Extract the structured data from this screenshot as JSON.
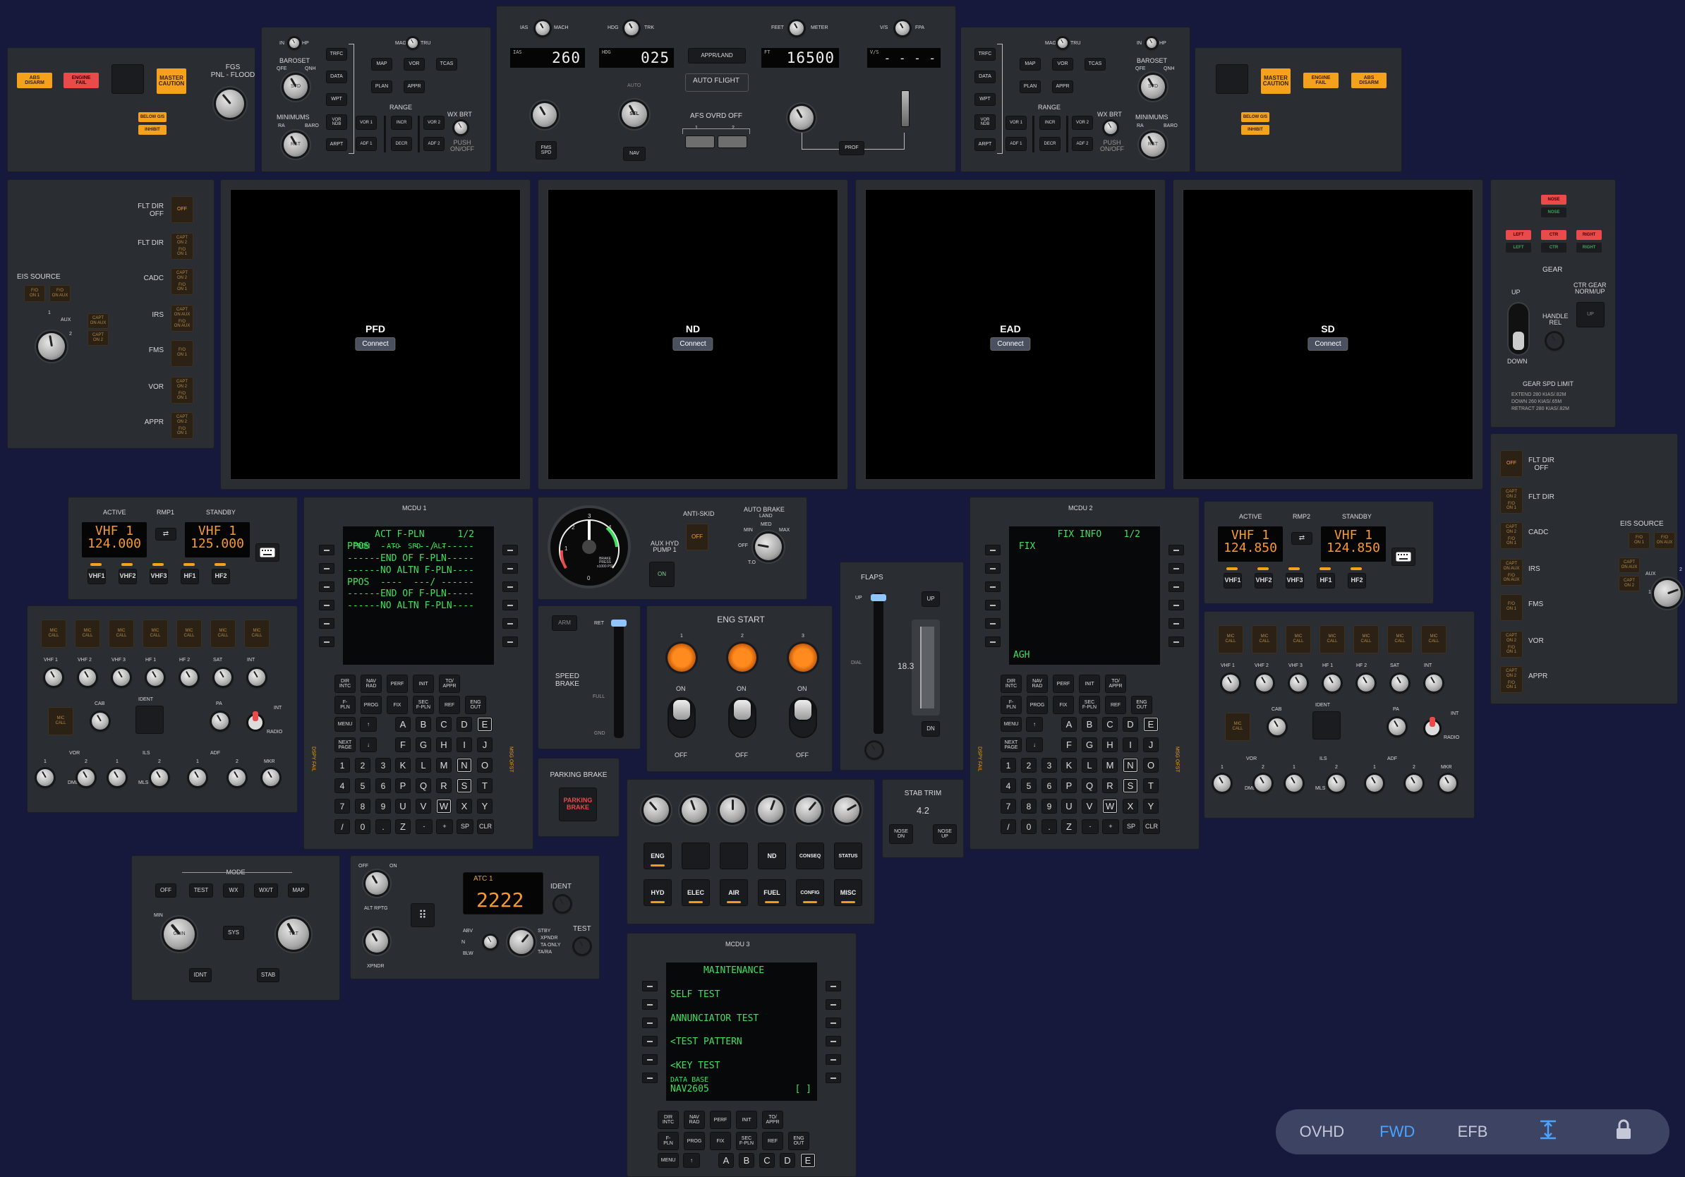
{
  "nav_bar": {
    "tabs": [
      "OVHD",
      "FWD",
      "EFB"
    ],
    "active": "FWD"
  },
  "displays": [
    {
      "title": "PFD",
      "button": "Connect"
    },
    {
      "title": "ND",
      "button": "Connect"
    },
    {
      "title": "EAD",
      "button": "Connect"
    },
    {
      "title": "SD",
      "button": "Connect"
    }
  ],
  "glare_left": {
    "abs_disarm": "ABS\nDISARM",
    "engine_fail": "ENGINE\nFAIL",
    "master_caution": "MASTER\nCAUTION",
    "below_gs": "BELOW G/S",
    "inhibit": "INHIBIT",
    "fgs_flood": "FGS\nPNL - FLOOD"
  },
  "efis_left": {
    "in": "IN",
    "hp": "HP",
    "baroset": "BAROSET",
    "qfe": "QFE",
    "qnh": "QNH",
    "std": "STD",
    "minimums": "MINIMUMS",
    "ra": "RA",
    "baro": "BARO",
    "rst": "RST",
    "mag": "MAG",
    "tru": "TRU",
    "trfc": "TRFC",
    "data": "DATA",
    "wpt": "WPT",
    "vor_ndb": "VOR\nNDB",
    "arpt": "ARPT",
    "map": "MAP",
    "vor": "VOR",
    "tcas": "TCAS",
    "plan": "PLAN",
    "appr": "APPR",
    "range": "RANGE",
    "vor1": "VOR 1",
    "incr": "INCR",
    "vor2": "VOR 2",
    "adf1": "ADF 1",
    "decr": "DECR",
    "adf2": "ADF 2",
    "wx_brt": "WX BRT",
    "push_onoff": "PUSH\nON/OFF"
  },
  "fcp": {
    "ias": "IAS",
    "mach": "MACH",
    "hdg": "HDG",
    "trk": "TRK",
    "feet": "FEET",
    "meter": "METER",
    "vs": "V/S",
    "fpa": "FPA",
    "ias_value": "260",
    "hdg_value": "025",
    "ft_value": "16500",
    "vs_value": "- - - -",
    "ias_tag": "IAS",
    "hdg_tag": "HDG",
    "ft_tag": "FT",
    "vs_tag": "V/S",
    "appr_land": "APPR/LAND",
    "auto_flight": "AUTO FLIGHT",
    "afs_ovrd_off": "AFS OVRD OFF",
    "one": "1",
    "two": "2",
    "fms_spd": "FMS\nSPD",
    "nav": "NAV",
    "prof": "PROF",
    "sel": "SEL",
    "auto": "AUTO"
  },
  "efis_right": {
    "trfc": "TRFC",
    "data": "DATA",
    "wpt": "WPT",
    "vor_ndb": "VOR\nNDB",
    "arpt": "ARPT",
    "mag": "MAG",
    "tru": "TRU",
    "map": "MAP",
    "vor": "VOR",
    "tcas": "TCAS",
    "plan": "PLAN",
    "appr": "APPR",
    "range": "RANGE",
    "vor1": "VOR 1",
    "incr": "INCR",
    "vor2": "VOR 2",
    "adf1": "ADF 1",
    "decr": "DECR",
    "adf2": "ADF 2",
    "in": "IN",
    "hp": "HP",
    "baroset": "BAROSET",
    "qfe": "QFE",
    "qnh": "QNH",
    "std": "STD",
    "wx_brt": "WX BRT",
    "push_onoff": "PUSH\nON/OFF",
    "minimums": "MINIMUMS",
    "ra": "RA",
    "baro": "BARO",
    "rst": "RST"
  },
  "glare_right": {
    "master_caution": "MASTER\nCAUTION",
    "engine_fail": "ENGINE\nFAIL",
    "abs_disarm": "ABS\nDISARM",
    "below_gs": "BELOW G/S",
    "inhibit": "INHIBIT"
  },
  "source_left": {
    "rows": [
      "FLT DIR\nOFF",
      "FLT DIR",
      "CADC",
      "IRS",
      "FMS",
      "VOR",
      "APPR"
    ],
    "eis_source": "EIS SOURCE",
    "fo_on1": "F/O\nON 1",
    "fo_on_aux": "F/O\nON AUX",
    "capt_on_aux": "CAPT\nON AUX",
    "capt_on2": "CAPT\nON 2",
    "aux": "AUX",
    "one": "1",
    "two": "2",
    "off": "OFF",
    "capt_on_2": "CAPT\nON 2",
    "fo_on_1": "F/O\nON 1"
  },
  "source_right": {
    "rows": [
      "FLT DIR\nOFF",
      "FLT DIR",
      "CADC",
      "IRS",
      "FMS",
      "VOR",
      "APPR"
    ],
    "eis_source": "EIS SOURCE",
    "fo_on1": "F/O\nON 1",
    "fo_on_aux": "F/O\nON AUX",
    "capt_on_aux": "CAPT\nON AUX",
    "capt_on2": "CAPT\nON 2",
    "aux": "AUX",
    "one": "1",
    "two": "2"
  },
  "gear": {
    "nose": "NOSE",
    "left": "LEFT",
    "ctr": "CTR",
    "right": "RIGHT",
    "title": "GEAR",
    "up": "UP",
    "down": "DOWN",
    "handle_rel": "HANDLE\nREL",
    "ctr_gear": "CTR GEAR\nNORM/UP",
    "gear_up": "UP",
    "spd_limit": "GEAR SPD LIMIT",
    "extend": "EXTEND 280 KIAS/.82M",
    "down_lim": "DOWN 260 KIAS/.65M",
    "retract": "RETRACT 280 KIAS/.82M"
  },
  "rmp1": {
    "active": "ACTIVE",
    "rmp": "RMP1",
    "standby": "STANDBY",
    "active_band": "VHF 1",
    "active_freq": "124.000",
    "standby_band": "VHF 1",
    "standby_freq": "125.000",
    "buttons": [
      "VHF1",
      "VHF2",
      "VHF3",
      "HF1",
      "HF2"
    ]
  },
  "rmp2": {
    "active": "ACTIVE",
    "rmp": "RMP2",
    "standby": "STANDBY",
    "active_band": "VHF 1",
    "active_freq": "124.850",
    "standby_band": "VHF 1",
    "standby_freq": "124.850",
    "buttons": [
      "VHF1",
      "VHF2",
      "VHF3",
      "HF1",
      "HF2"
    ]
  },
  "acp": {
    "mic_call": "MIC\nCALL",
    "channels": [
      "VHF 1",
      "VHF 2",
      "VHF 3",
      "HF 1",
      "HF 2",
      "SAT",
      "INT"
    ],
    "cab": "CAB",
    "ident": "IDENT",
    "pa": "PA",
    "int": "INT",
    "radio": "RADIO",
    "vor": "VOR",
    "ils": "ILS",
    "adf": "ADF",
    "mkr": "MKR",
    "dme": "DME",
    "mls": "MLS",
    "one": "1",
    "two": "2"
  },
  "mcdu1": {
    "title": "MCDU 1",
    "screen": "     ACT F-PLN      1/2\nPPOS  ----  ---/ ------\n------END OF F-PLN-----\n------NO ALTN F-PLN----\nPPOS  ----  ---/ ------\n------END OF F-PLN-----\n------NO ALTN F-PLN----",
    "hdr": "FROM    ATO  SPD   ALT"
  },
  "mcdu2": {
    "title": "MCDU 2",
    "screen": "        FIX INFO    1/2\n FIX",
    "bottom": "AGH"
  },
  "mcdu3": {
    "title": "MCDU 3",
    "screen": "      MAINTENANCE\n\nSELF TEST\n\nANNUNCIATOR TEST\n\n<TEST PATTERN\n\n<KEY TEST",
    "db": "DATA BASE",
    "db_ver": "NAV2605",
    "bracket": "[ ]"
  },
  "mcdu_keys": {
    "fn1": [
      "DIR\nINTC",
      "NAV\nRAD",
      "PERF",
      "INIT",
      "TO/\nAPPR"
    ],
    "fn2": [
      "F-\nPLN",
      "PROG",
      "FIX",
      "SEC\nF-PLN",
      "REF",
      "ENG\nOUT"
    ],
    "menu": "MENU",
    "next_page": "NEXT\nPAGE",
    "letters": [
      "A",
      "B",
      "C",
      "D",
      "E",
      "F",
      "G",
      "H",
      "I",
      "J",
      "K",
      "L",
      "M",
      "N",
      "O",
      "P",
      "Q",
      "R",
      "S",
      "T",
      "U",
      "V",
      "W",
      "X",
      "Y",
      "Z",
      "-",
      "+",
      "SP",
      "CLR"
    ],
    "nums": [
      "1",
      "2",
      "3",
      "4",
      "5",
      "6",
      "7",
      "8",
      "9",
      "/",
      "0",
      "."
    ],
    "dspy": "DSPY FAIL",
    "msg": "MSG OFST"
  },
  "center": {
    "brake_press": "BRAKE\nPRESS\nx1000 PSI",
    "anti_skid": "ANTI-SKID",
    "off": "OFF",
    "aux_hyd": "AUX HYD\nPUMP 1",
    "on": "ON",
    "auto_brake": "AUTO BRAKE",
    "land": "LAND",
    "med": "MED",
    "min": "MIN",
    "max": "MAX",
    "to": "T.O",
    "eng_start": "ENG START",
    "eng_nums": [
      "1",
      "2",
      "3"
    ],
    "on_label": "ON",
    "off_label": "OFF",
    "arm": "ARM",
    "ret": "RET",
    "full": "FULL",
    "gnd": "GND",
    "speed_brake": "SPEED\nBRAKE",
    "parking_brake": "PARKING BRAKE",
    "parking_btn": "PARKING\nBRAKE",
    "flaps": "FLAPS",
    "up": "UP",
    "dn": "DN",
    "dial": "DIAL",
    "flap_value": "18.3",
    "stab_trim": "STAB TRIM",
    "stab_value": "4.2",
    "nose_dn": "NOSE\nDN",
    "nose_up": "NOSE\nUP"
  },
  "sd_control": {
    "row1": [
      "ENG",
      "",
      "",
      "ND",
      "CONSEQ",
      "STATUS"
    ],
    "row2": [
      "HYD",
      "ELEC",
      "AIR",
      "FUEL",
      "CONFIG",
      "MISC"
    ]
  },
  "radar": {
    "mode": "MODE",
    "modes": [
      "OFF",
      "TEST",
      "WX",
      "WX/T",
      "MAP"
    ],
    "gain": "GAIN",
    "min": "MIN",
    "tilt": "TILT",
    "sys": "SYS",
    "idnt": "IDNT",
    "stab": "STAB"
  },
  "atc": {
    "label": "ATC 1",
    "code": "2222",
    "ident": "IDENT",
    "alt_rptg": "ALT RPTG",
    "xpndr": "XPNDR",
    "abv": "ABV",
    "n": "N",
    "blw": "BLW",
    "test": "TEST",
    "stby": "STBY",
    "xpndr_mode": "XPNDR",
    "ta_only": "TA ONLY",
    "tara": "TA/RA",
    "off": "OFF",
    "on": "ON"
  },
  "colors": {
    "amber": "#f4a21c",
    "red": "#e94b4b",
    "green": "#3ee15e",
    "nav_active": "#4aa3ff",
    "panel": "#2a2d32",
    "background": "#16193b"
  }
}
